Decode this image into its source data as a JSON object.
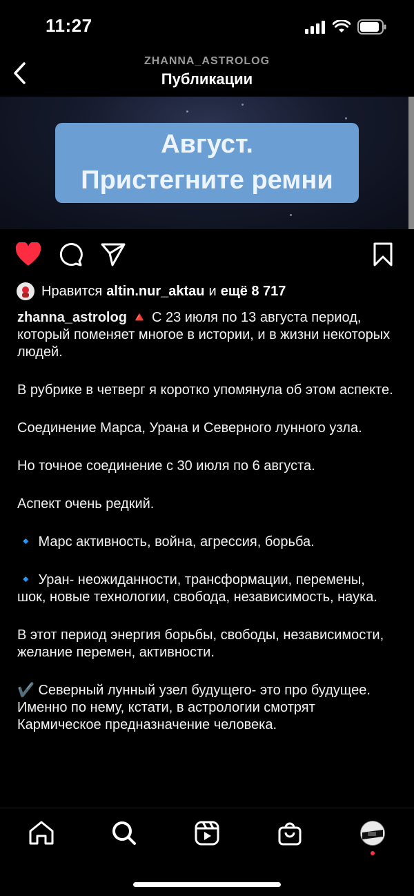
{
  "status": {
    "time": "11:27"
  },
  "nav": {
    "subtitle": "ZHANNA_ASTROLOG",
    "title": "Публикации"
  },
  "post": {
    "image_caption": [
      "Август.",
      "Пристегните ремни"
    ],
    "likes": {
      "prefix": "Нравится",
      "user": "altin.nur_aktau",
      "middle": "и",
      "count": "ещё 8 717"
    },
    "author": "zhanna_astrolog",
    "caption": {
      "p1": "С 23 июля  по 13 августа период, который поменяет многое в истории, и в жизни некоторых людей.",
      "p2": "В рубрике в четверг я коротко упомянула об этом аспекте.",
      "p3": "Соединение Марса, Урана и Северного лунного узла.",
      "p4": "Но точное соединение с 30  июля по 6 августа.",
      "p5": "Аспект очень редкий.",
      "p6": "Марс активность, война, агрессия, борьба.",
      "p7": "Уран- неожиданности, трансформации, перемены, шок, новые технологии, свобода, независимость, наука.",
      "p8": "В этот период энергия борьбы, свободы, независимости, желание перемен, активности.",
      "p9": "Северный лунный узел будущего- это про будущее. Именно по нему, кстати, в астрологии смотрят Кармическое предназначение человека."
    },
    "emoji": {
      "triangle": "🔺",
      "diamond": "🔹",
      "check": "✔️"
    }
  },
  "icons": {
    "back": "chevron-left-icon",
    "like": "heart-icon",
    "comment": "comment-icon",
    "share": "send-icon",
    "save": "bookmark-icon",
    "home": "home-icon",
    "search": "search-icon",
    "reels": "reels-icon",
    "shop": "shop-icon"
  },
  "colors": {
    "like": "#fe2c40",
    "image_label": "#6b9ed3",
    "notification": "#ff3040"
  }
}
